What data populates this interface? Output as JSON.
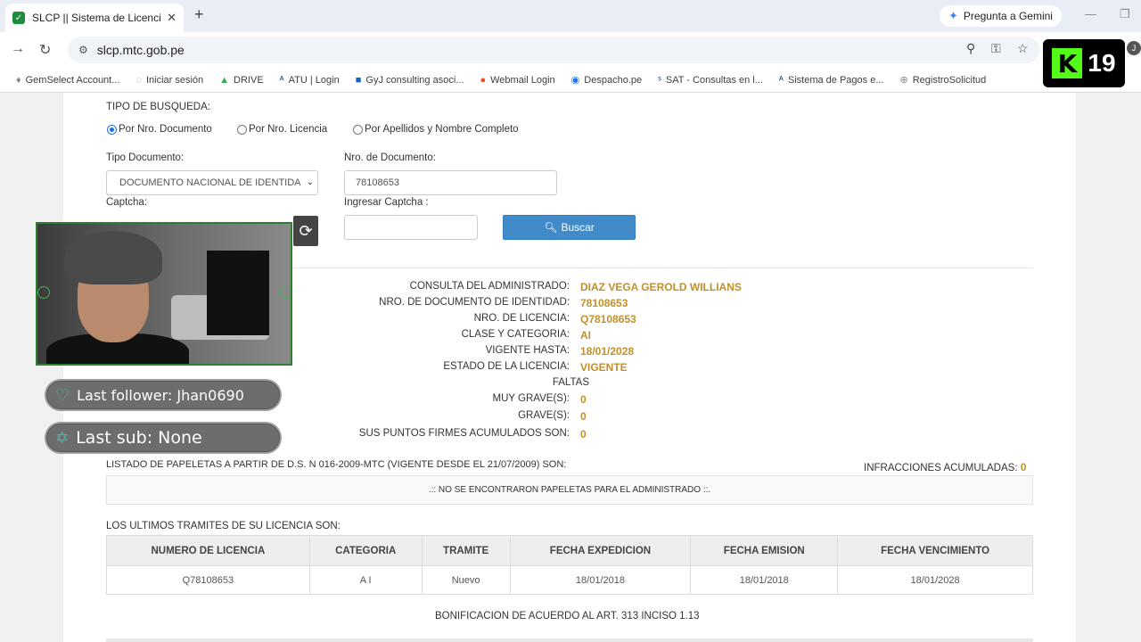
{
  "browser": {
    "tab_title": "SLCP || Sistema de Licencias de",
    "tab_close": "✕",
    "new_tab": "+",
    "gemini_label": "Pregunta a Gemini",
    "url": "slcp.mtc.gob.pe",
    "profile_initial": "J",
    "bookmarks": [
      "GemSelect Account...",
      "Iniciar sesión",
      "DRIVE",
      "ATU | Login",
      "GyJ consulting asoci...",
      "Webmail Login",
      "Despacho.pe",
      "SAT - Consultas en l...",
      "Sistema de Pagos e...",
      "RegistroSolicitud"
    ]
  },
  "overlay": {
    "k_letter": "K",
    "k_number": "19",
    "last_follower": "Last follower: Jhan0690",
    "last_sub": "Last sub: None"
  },
  "search": {
    "tipo_busqueda": "TIPO DE BUSQUEDA:",
    "radio_documento": "Por Nro. Documento",
    "radio_licencia": "Por Nro. Licencia",
    "radio_nombre": "Por Apellidos y Nombre Completo",
    "tipo_documento_label": "Tipo Documento:",
    "tipo_documento_value": "DOCUMENTO NACIONAL DE IDENTIDAD",
    "nro_documento_label": "Nro. de Documento:",
    "nro_documento_value": "78108653",
    "captcha_label": "Captcha:",
    "ingresar_captcha_label": "Ingresar Captcha :",
    "buscar_label": "Buscar"
  },
  "result": {
    "rows": [
      {
        "k": "CONSULTA DEL ADMINISTRADO:",
        "v": "DIAZ VEGA GEROLD WILLIANS"
      },
      {
        "k": "NRO. DE DOCUMENTO DE IDENTIDAD:",
        "v": "78108653"
      },
      {
        "k": "NRO. DE LICENCIA:",
        "v": "Q78108653"
      },
      {
        "k": "CLASE Y CATEGORIA:",
        "v": "AI"
      },
      {
        "k": "VIGENTE HASTA:",
        "v": "18/01/2028"
      },
      {
        "k": "ESTADO DE LA LICENCIA:",
        "v": "VIGENTE"
      },
      {
        "k": "FALTAS",
        "v": ""
      },
      {
        "k": "MUY GRAVE(S):",
        "v": "0"
      },
      {
        "k": "GRAVE(S):",
        "v": "0"
      },
      {
        "k": "SUS PUNTOS FIRMES ACUMULADOS SON:",
        "v": "0"
      }
    ],
    "listado_label": "LISTADO DE PAPELETAS A PARTIR DE D.S. N 016-2009-MTC (VIGENTE DESDE EL 21/07/2009) SON:",
    "infracciones_label": "INFRACCIONES ACUMULADAS:",
    "infracciones_value": "0",
    "notice": ".:: NO SE ENCONTRARON PAPELETAS PARA EL ADMINISTRADO ::.",
    "tramites_label": "LOS ULTIMOS TRAMITES DE SU LICENCIA SON:",
    "bonificacion_label": "BONIFICACION DE ACUERDO AL ART. 313 INCISO 1.13"
  },
  "tramites_table": {
    "headers": [
      "NUMERO DE LICENCIA",
      "CATEGORIA",
      "TRAMITE",
      "FECHA EXPEDICION",
      "FECHA EMISION",
      "FECHA VENCIMIENTO"
    ],
    "rows": [
      [
        "Q78108653",
        "A I",
        "Nuevo",
        "18/01/2018",
        "18/01/2018",
        "18/01/2028"
      ]
    ]
  }
}
